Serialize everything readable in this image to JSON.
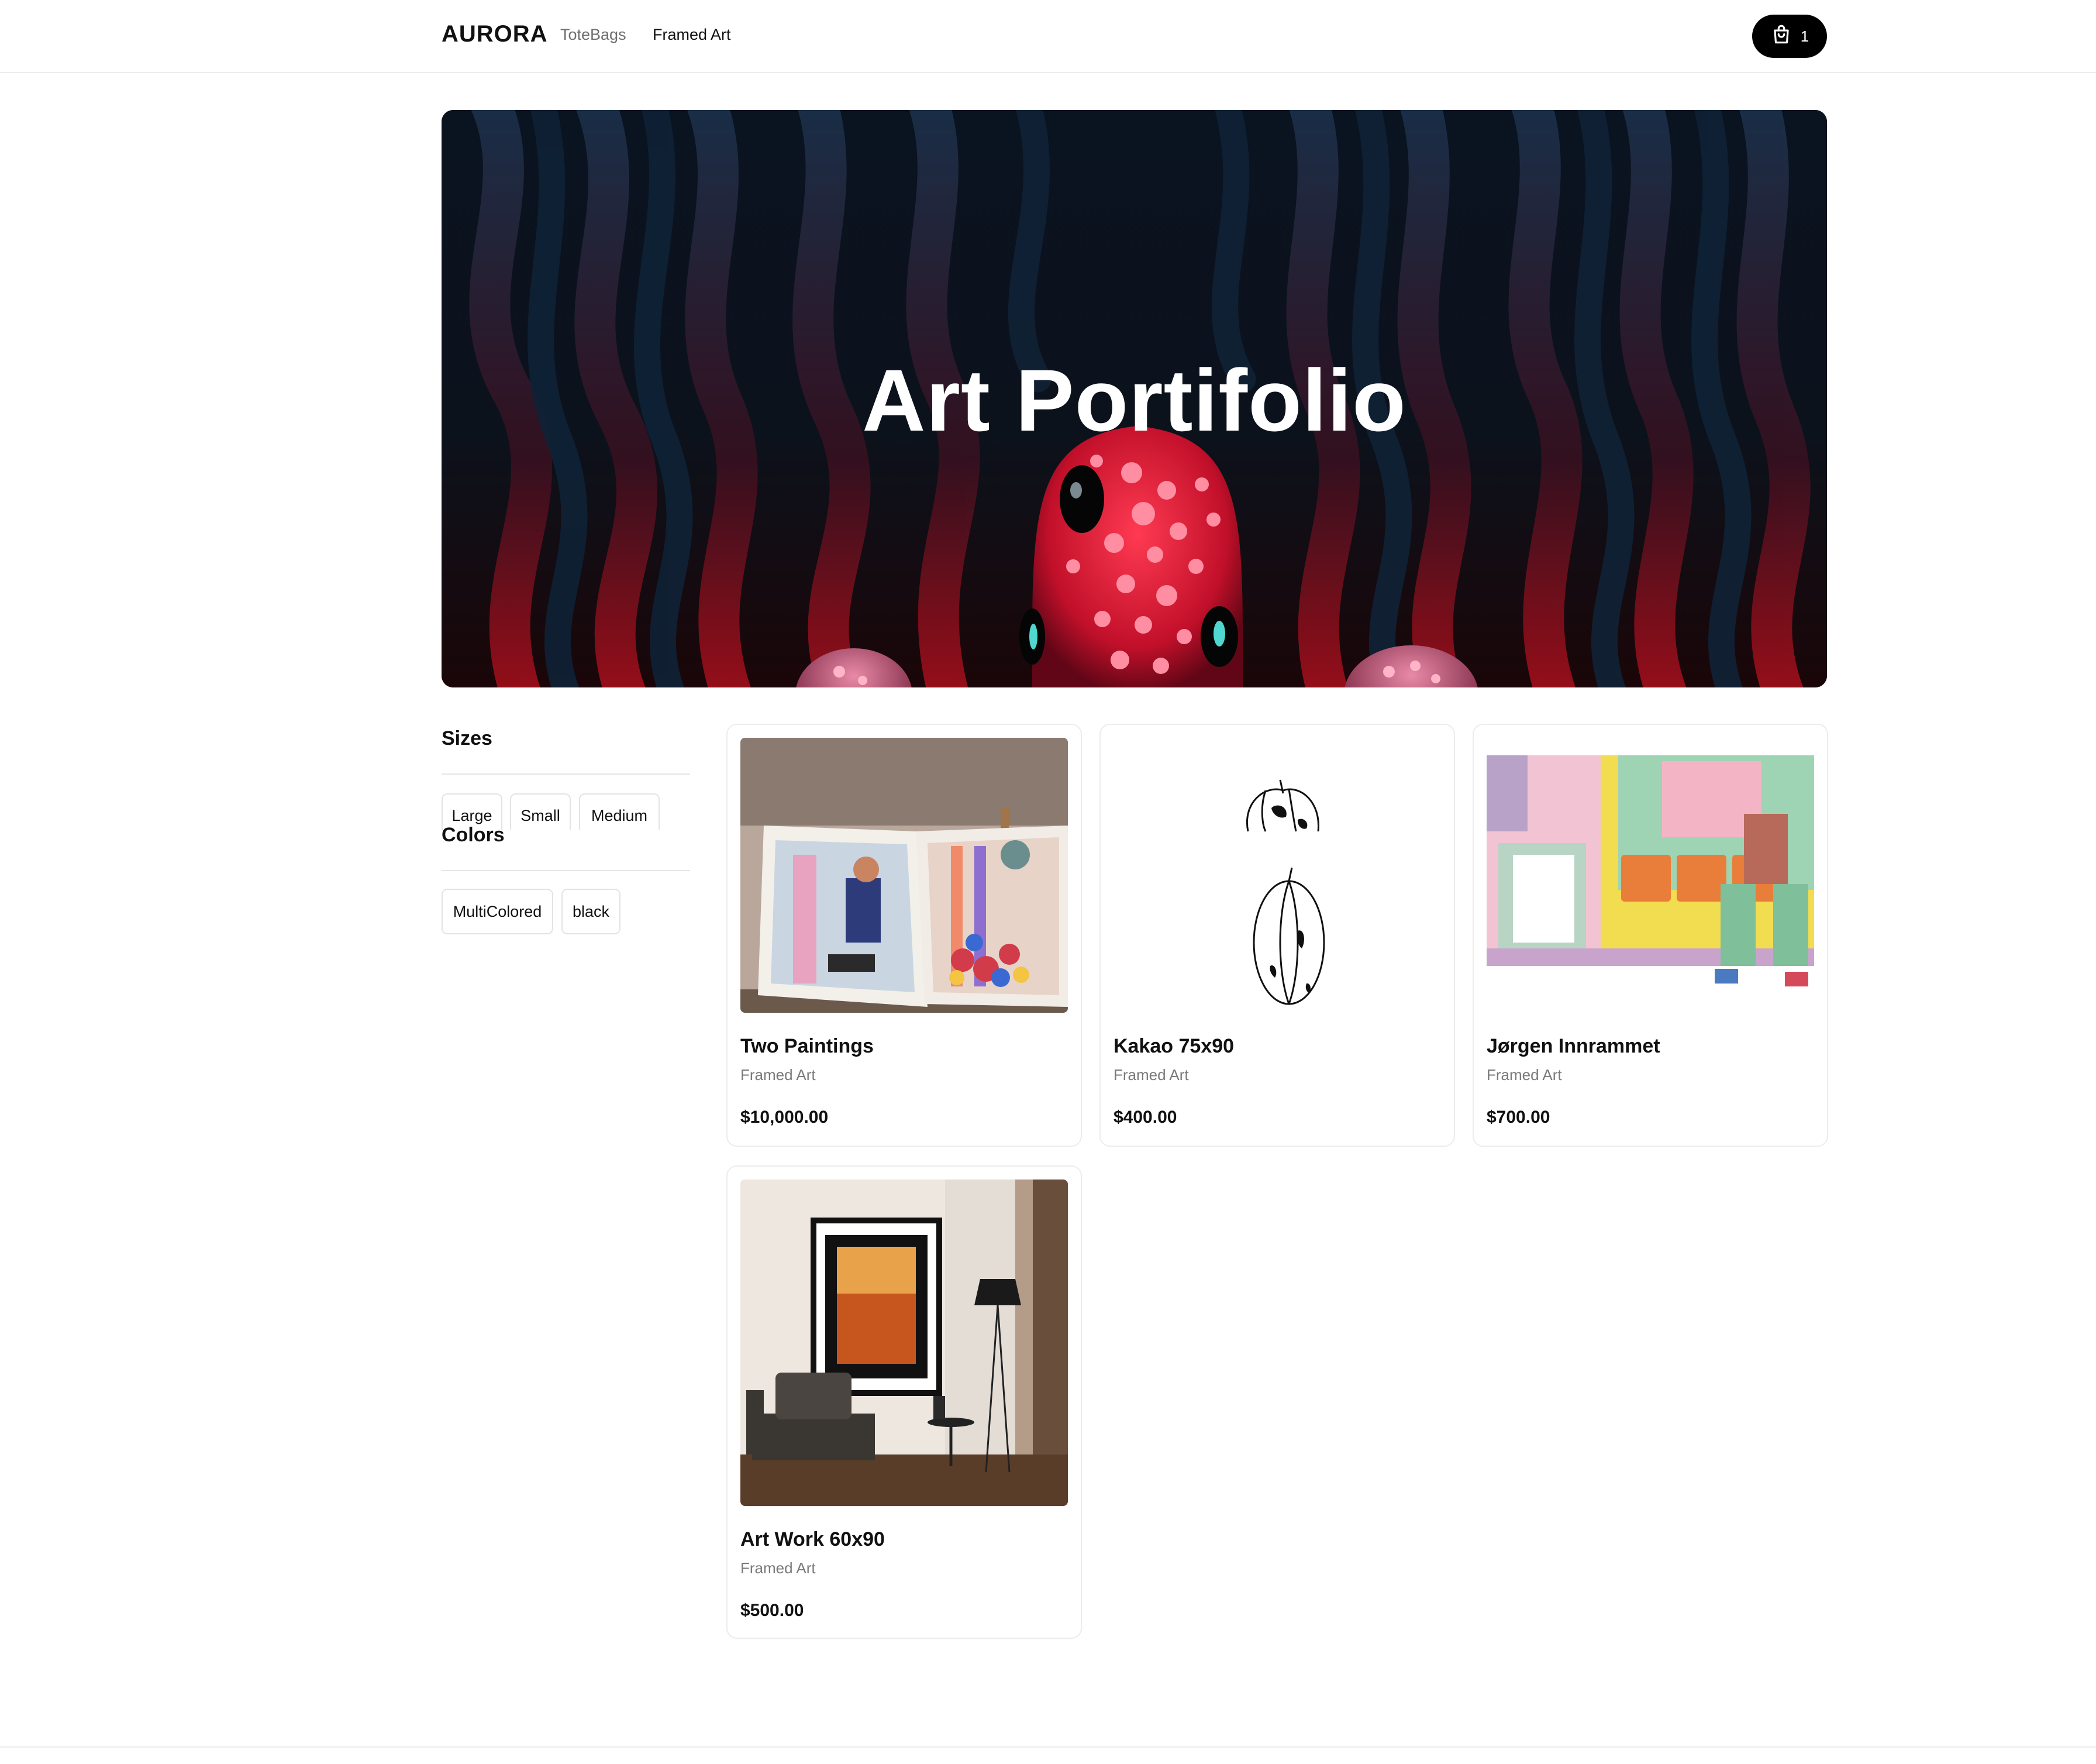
{
  "header": {
    "logo": "AURORA",
    "nav": [
      "ToteBags",
      "Framed Art"
    ],
    "cart_count": "1"
  },
  "hero": {
    "title": "Art Portifolio"
  },
  "filters": {
    "sizes_heading": "Sizes",
    "sizes": [
      "Large",
      "Small",
      "Medium"
    ],
    "colors_heading": "Colors",
    "colors": [
      "MultiColored",
      "black"
    ]
  },
  "products": [
    {
      "title": "Two Paintings",
      "category": "Framed Art",
      "price": "$10,000.00"
    },
    {
      "title": "Kakao 75x90",
      "category": "Framed Art",
      "price": "$400.00"
    },
    {
      "title": "Jørgen Innrammet",
      "category": "Framed Art",
      "price": "$700.00"
    },
    {
      "title": "Art Work 60x90",
      "category": "Framed Art",
      "price": "$500.00"
    }
  ],
  "colors": {
    "accent": "#000000",
    "muted_text": "#7a7a7a",
    "border": "#ececec"
  },
  "icons": {
    "cart": "shopping-bag-icon"
  }
}
